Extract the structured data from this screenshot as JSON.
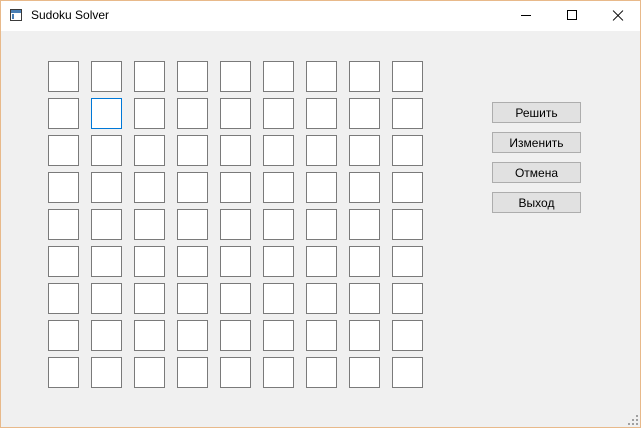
{
  "window": {
    "title": "Sudoku Solver",
    "icon": "app-window-icon",
    "controls": [
      "minimize-icon",
      "maximize-icon",
      "close-icon"
    ]
  },
  "grid": {
    "rows": 9,
    "columns": 9,
    "values": [
      [
        "",
        "",
        "",
        "",
        "",
        "",
        "",
        "",
        ""
      ],
      [
        "",
        "",
        "",
        "",
        "",
        "",
        "",
        "",
        ""
      ],
      [
        "",
        "",
        "",
        "",
        "",
        "",
        "",
        "",
        ""
      ],
      [
        "",
        "",
        "",
        "",
        "",
        "",
        "",
        "",
        ""
      ],
      [
        "",
        "",
        "",
        "",
        "",
        "",
        "",
        "",
        ""
      ],
      [
        "",
        "",
        "",
        "",
        "",
        "",
        "",
        "",
        ""
      ],
      [
        "",
        "",
        "",
        "",
        "",
        "",
        "",
        "",
        ""
      ],
      [
        "",
        "",
        "",
        "",
        "",
        "",
        "",
        "",
        ""
      ],
      [
        "",
        "",
        "",
        "",
        "",
        "",
        "",
        "",
        ""
      ]
    ],
    "focused_cell": {
      "row": 1,
      "col": 1
    },
    "focus_color": "#0078d7"
  },
  "buttons": {
    "solve": "Решить",
    "edit": "Изменить",
    "cancel": "Отмена",
    "exit": "Выход"
  }
}
